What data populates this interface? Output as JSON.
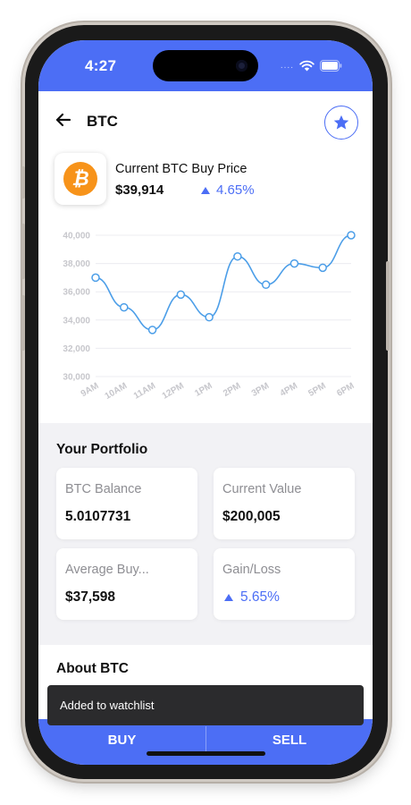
{
  "status_bar": {
    "time": "4:27",
    "signal_dots": "....",
    "bg_color": "#4c6ef5"
  },
  "header": {
    "title": "BTC",
    "back_icon": "arrow-left-icon",
    "favorite_icon": "star-icon"
  },
  "coin": {
    "logo_icon": "bitcoin-icon",
    "logo_symbol": "₿",
    "price_label": "Current BTC Buy Price",
    "price_value": "$39,914",
    "price_change": "4.65%",
    "change_direction": "up"
  },
  "chart_data": {
    "type": "line",
    "categories": [
      "9AM",
      "10AM",
      "11AM",
      "12PM",
      "1PM",
      "2PM",
      "3PM",
      "4PM",
      "5PM",
      "6PM"
    ],
    "series": [
      {
        "values": [
          37000,
          34900,
          33300,
          35800,
          34200,
          38500,
          36500,
          38000,
          37700,
          40000
        ]
      }
    ],
    "y_ticks": [
      "30,000",
      "32,000",
      "34,000",
      "36,000",
      "38,000",
      "40,000"
    ],
    "ylim": [
      30000,
      40000
    ],
    "grid": true,
    "line_color": "#4c9ee8"
  },
  "portfolio": {
    "title": "Your Portfolio",
    "cards": [
      {
        "label": "BTC Balance",
        "value": "5.0107731"
      },
      {
        "label": "Current Value",
        "value": "$200,005"
      },
      {
        "label": "Average Buy...",
        "value": "$37,598"
      },
      {
        "label": "Gain/Loss",
        "value": "5.65%",
        "direction": "up"
      }
    ]
  },
  "about": {
    "title": "About BTC"
  },
  "toast": {
    "message": "Added to watchlist"
  },
  "actions": {
    "buy_label": "BUY",
    "sell_label": "SELL"
  },
  "colors": {
    "accent": "#4c6ef5",
    "bitcoin": "#f7931a",
    "section_bg": "#f2f2f5"
  }
}
